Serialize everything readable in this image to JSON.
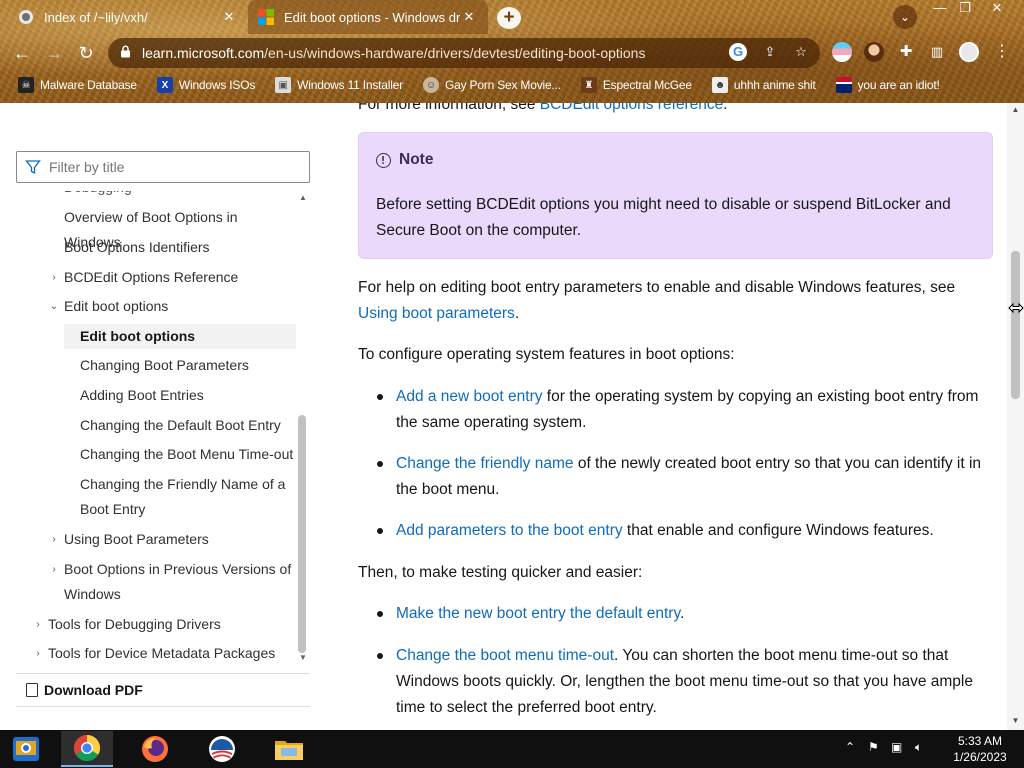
{
  "browser": {
    "tabs": [
      {
        "title": "Index of /~lily/vxh/",
        "favicon": "generic-page-icon"
      },
      {
        "title": "Edit boot options - Windows driv",
        "favicon": "microsoft-logo-icon",
        "active": true
      }
    ],
    "close_glyph": "✕",
    "new_tab_glyph": "+",
    "tab_search_glyph": "⌄",
    "window_controls": {
      "minimize": "—",
      "restore": "❐",
      "close": "✕"
    },
    "address": {
      "host": "learn.microsoft.com",
      "path": "/en-us/windows-hardware/drivers/devtest/editing-boot-options"
    },
    "bookmarks": [
      {
        "label": "Malware Database",
        "icon": "skull-icon"
      },
      {
        "label": "Windows ISOs",
        "icon": "x-logo-icon"
      },
      {
        "label": "Windows 11 Installer",
        "icon": "image-icon"
      },
      {
        "label": "Gay Porn Sex Movie...",
        "icon": "face-icon"
      },
      {
        "label": "Espectral McGee",
        "icon": "hat-icon"
      },
      {
        "label": "uhhh anime shit",
        "icon": "anime-face-icon"
      },
      {
        "label": "you are an idiot!",
        "icon": "flag-icon"
      }
    ]
  },
  "sidebar": {
    "filter_placeholder": "Filter by title",
    "toc": [
      {
        "label": "Overview of Boot Options in Windows",
        "level": 1,
        "chevron": ""
      },
      {
        "label": "Boot Options Identifiers",
        "level": 1,
        "chevron": ""
      },
      {
        "label": "BCDEdit Options Reference",
        "level": 1,
        "chevron": "›"
      },
      {
        "label": "Edit boot options",
        "level": 1,
        "chevron": "⌄"
      },
      {
        "label": "Edit boot options",
        "level": 2,
        "chevron": "",
        "active": true
      },
      {
        "label": "Changing Boot Parameters",
        "level": 2,
        "chevron": ""
      },
      {
        "label": "Adding Boot Entries",
        "level": 2,
        "chevron": ""
      },
      {
        "label": "Changing the Default Boot Entry",
        "level": 2,
        "chevron": ""
      },
      {
        "label": "Changing the Boot Menu Time-out",
        "level": 2,
        "chevron": ""
      },
      {
        "label": "Changing the Friendly Name of a",
        "label2": "Boot Entry",
        "level": 2,
        "chevron": ""
      },
      {
        "label": "Using Boot Parameters",
        "level": 1,
        "chevron": "›"
      },
      {
        "label": "Boot Options in Previous Versions of",
        "label2": "Windows",
        "level": 1,
        "chevron": "›"
      },
      {
        "label": "Tools for Debugging Drivers",
        "level": 0,
        "chevron": "›"
      },
      {
        "label": "Tools for Device Metadata Packages",
        "level": 0,
        "chevron": "›"
      }
    ],
    "download_pdf": "Download PDF"
  },
  "content": {
    "top_line_prefix": "For more information, see ",
    "top_line_link": "BCDEdit options reference",
    "top_line_suffix": ".",
    "note": {
      "title": "Note",
      "body": "Before setting BCDEdit options you might need to disable or suspend BitLocker and Secure Boot on the computer."
    },
    "para1_text": "For help on editing boot entry parameters to enable and disable Windows features, see ",
    "para1_link": "Using boot parameters",
    "para1_suffix": ".",
    "para2": "To configure operating system features in boot options:",
    "bullets1": [
      {
        "link": "Add a new boot entry",
        "text": " for the operating system by copying an existing boot entry from the same operating system."
      },
      {
        "link": "Change the friendly name",
        "text": " of the newly created boot entry so that you can identify it in the boot menu."
      },
      {
        "link": "Add parameters to the boot entry",
        "text": " that enable and configure Windows features."
      }
    ],
    "para3": "Then, to make testing quicker and easier:",
    "bullets2": [
      {
        "link": "Make the new boot entry the default entry",
        "text": "."
      },
      {
        "link": "Change the boot menu time-out",
        "text": ". You can shorten the boot menu time-out so that Windows boots quickly. Or, lengthen the boot menu time-out so that you have ample time to select the preferred boot entry."
      }
    ]
  },
  "taskbar": {
    "apps": [
      {
        "name": "File Explorer",
        "icon": "file-explorer-icon"
      },
      {
        "name": "Google Chrome",
        "icon": "chrome-icon",
        "active": true
      },
      {
        "name": "Firefox",
        "icon": "firefox-icon"
      },
      {
        "name": "Obama Logo",
        "icon": "obama-logo-icon"
      },
      {
        "name": "Folder",
        "icon": "folder-icon"
      }
    ],
    "time": "5:33 AM",
    "date": "1/26/2023"
  },
  "colors": {
    "link": "#0f6cbd",
    "note_bg": "#ebd9fc",
    "chrome_theme": "#a66a20",
    "taskbar": "#101010"
  }
}
